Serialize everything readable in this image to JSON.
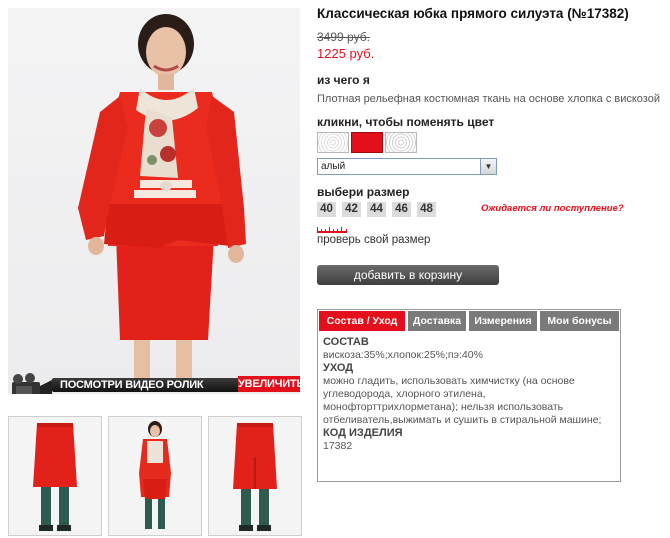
{
  "product": {
    "title": "Классическая юбка прямого силуэта (№17382)",
    "old_price": "3499 руб.",
    "new_price": "1225 руб."
  },
  "photo": {
    "video_label": "ПОСМОТРИ ВИДЕО РОЛИК",
    "zoom_label": "УВЕЛИЧИТЬ"
  },
  "material": {
    "label": "из чего я",
    "text": "Плотная рельефная костюмная ткань на основе хлопка с вискозой"
  },
  "color": {
    "label": "кликни, чтобы поменять цвет",
    "selected": "алый",
    "swatch_colors": [
      "#ffffff",
      "#e3101c",
      "#ffffff"
    ]
  },
  "size": {
    "label": "выбери размер",
    "options": [
      "40",
      "42",
      "44",
      "46",
      "48"
    ],
    "awaiting": "Ожидается ли поступление?",
    "check_size": "проверь свой размер"
  },
  "cart": {
    "add_label": "добавить в корзину"
  },
  "tabs": {
    "items": [
      "Состав / Уход",
      "Доставка",
      "Измерения",
      "Мои бонусы"
    ],
    "active": 0,
    "content": {
      "composition_heading": "СОСТАВ",
      "composition_text": "вискоза:35%;хлопок:25%;пэ:40%",
      "care_heading": "УХОД",
      "care_text": "можно гладить, использовать химчистку (на основе углеводорода, хлорного этилена, монофторттрихлорметана); нельзя использовать отбеливатель,выжимать и сушить в стиральной машине;",
      "code_heading": "КОД ИЗДЕЛИЯ",
      "code_value": "17382"
    }
  },
  "colors": {
    "accent": "#e3101c",
    "dark_button": "#4a4a4a",
    "tab_inactive": "#7a7a7a"
  }
}
